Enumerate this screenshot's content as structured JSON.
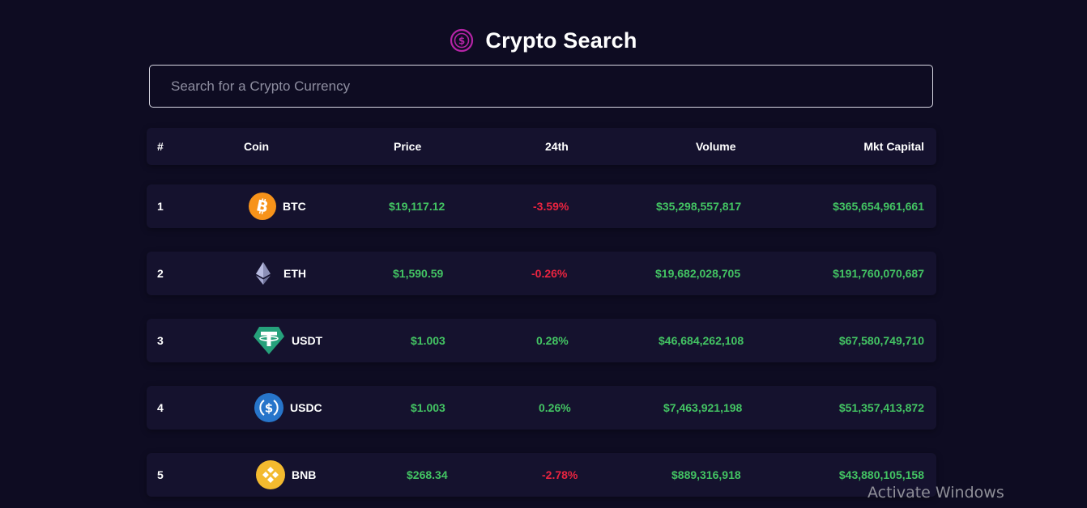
{
  "app": {
    "title": "Crypto Search",
    "logo_icon": "dollar-coin-icon",
    "accent": "#b524a6"
  },
  "search": {
    "placeholder": "Search for a Crypto Currency",
    "value": ""
  },
  "table": {
    "headers": {
      "rank": "#",
      "coin": "Coin",
      "price": "Price",
      "change": "24th",
      "volume": "Volume",
      "mkt_cap": "Mkt Capital"
    },
    "rows": [
      {
        "rank": "1",
        "symbol": "BTC",
        "icon": "bitcoin-icon",
        "price": "$19,117.12",
        "change": "-3.59%",
        "volume": "$35,298,557,817",
        "mkt_cap": "$365,654,961,661"
      },
      {
        "rank": "2",
        "symbol": "ETH",
        "icon": "ethereum-icon",
        "price": "$1,590.59",
        "change": "-0.26%",
        "volume": "$19,682,028,705",
        "mkt_cap": "$191,760,070,687"
      },
      {
        "rank": "3",
        "symbol": "USDT",
        "icon": "tether-icon",
        "price": "$1.003",
        "change": "0.28%",
        "volume": "$46,684,262,108",
        "mkt_cap": "$67,580,749,710"
      },
      {
        "rank": "4",
        "symbol": "USDC",
        "icon": "usd-coin-icon",
        "price": "$1.003",
        "change": "0.26%",
        "volume": "$7,463,921,198",
        "mkt_cap": "$51,357,413,872"
      },
      {
        "rank": "5",
        "symbol": "BNB",
        "icon": "binance-coin-icon",
        "price": "$268.34",
        "change": "-2.78%",
        "volume": "$889,316,918",
        "mkt_cap": "$43,880,105,158"
      }
    ]
  },
  "colors": {
    "background": "#0e0c22",
    "row_bg": "#15122e",
    "positive": "#43c463",
    "negative": "#ea2440"
  },
  "overlay": {
    "watermark": "Activate Windows"
  }
}
